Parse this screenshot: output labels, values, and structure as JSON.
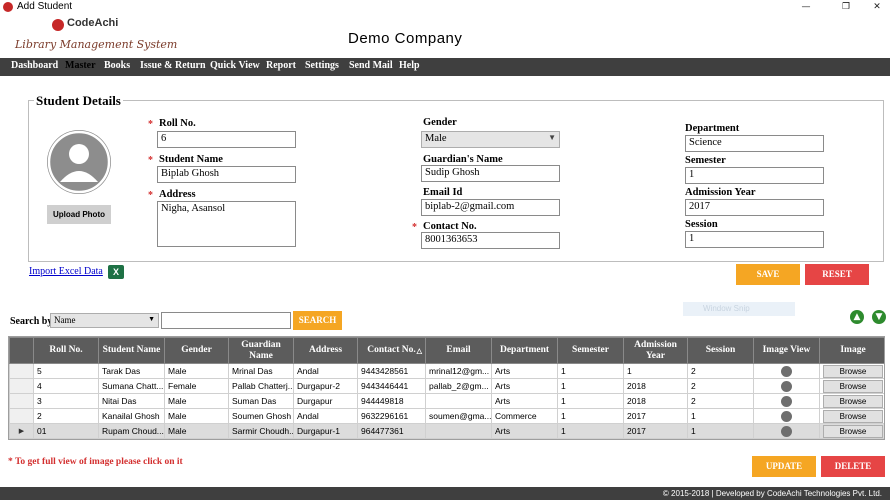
{
  "window": {
    "title": "Add Student",
    "minimize": "—",
    "restore": "❐",
    "close": "✕"
  },
  "header": {
    "logo": "CodeAchi",
    "logo_subtitle": "Library Management System",
    "company": "Demo Company"
  },
  "menu": [
    "Dashboard",
    "Master",
    "Books",
    "Issue & Return",
    "Quick View",
    "Report",
    "Settings",
    "Send Mail",
    "Help"
  ],
  "form": {
    "title": "Student Details",
    "upload_label": "Upload Photo",
    "required_mark": "*",
    "roll_label": "Roll No.",
    "roll_value": "6",
    "name_label": "Student Name",
    "name_value": "Biplab Ghosh",
    "address_label": "Address",
    "address_value": "Nigha, Asansol",
    "gender_label": "Gender",
    "gender_value": "Male",
    "guardian_label": "Guardian's Name",
    "guardian_value": "Sudip Ghosh",
    "email_label": "Email Id",
    "email_value": "biplab-2@gmail.com",
    "contact_label": "Contact No.",
    "contact_value": "8001363653",
    "department_label": "Department",
    "department_value": "Science",
    "semester_label": "Semester",
    "semester_value": "1",
    "admission_label": "Admission Year",
    "admission_value": "2017",
    "session_label": "Session",
    "session_value": "1"
  },
  "import_link": "Import Excel Data",
  "buttons": {
    "save": "SAVE",
    "reset": "RESET",
    "search": "SEARCH",
    "update": "UPDATE",
    "delete": "DELETE"
  },
  "search": {
    "label": "Search by",
    "by_value": "Name"
  },
  "ghost_tip": "Window Snip",
  "grid": {
    "columns": [
      "Roll No.",
      "Student Name",
      "Gender",
      "Guardian Name",
      "Address",
      "Contact No.",
      "Email",
      "Department",
      "Semester",
      "Admission Year",
      "Session",
      "Image View",
      "Image"
    ],
    "rows": [
      [
        "5",
        "Tarak Das",
        "Male",
        "Mrinal Das",
        "Andal",
        "9443428561",
        "mrinal12@gm...",
        "Arts",
        "1",
        "1",
        "2",
        "",
        "Browse"
      ],
      [
        "4",
        "Sumana Chatt...",
        "Female",
        "Pallab Chatterj...",
        "Durgapur-2",
        "9443446441",
        "pallab_2@gm...",
        "Arts",
        "1",
        "2018",
        "2",
        "",
        "Browse"
      ],
      [
        "3",
        "Nitai Das",
        "Male",
        "Suman Das",
        "Durgapur",
        "944449818",
        "",
        "Arts",
        "1",
        "2018",
        "2",
        "",
        "Browse"
      ],
      [
        "2",
        "Kanailal Ghosh",
        "Male",
        "Soumen Ghosh",
        "Andal",
        "9632296161",
        "soumen@gma...",
        "Commerce",
        "1",
        "2017",
        "1",
        "",
        "Browse"
      ],
      [
        "01",
        "Rupam Choud...",
        "Male",
        "Sarmir Choudh...",
        "Durgapur-1",
        "964477361",
        "",
        "Arts",
        "1",
        "2017",
        "1",
        "",
        "Browse"
      ]
    ]
  },
  "note": "* To get full view of image please click on it",
  "footer": "© 2015-2018 | Developed by CodeAchi Technologies Pvt. Ltd."
}
